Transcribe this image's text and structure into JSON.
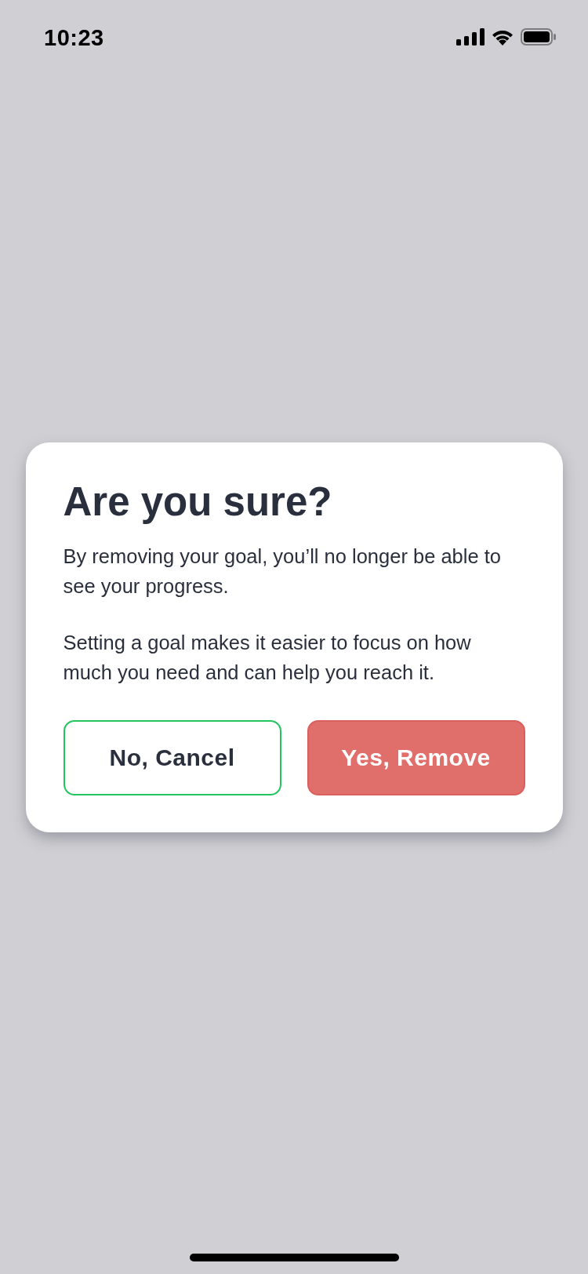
{
  "status_bar": {
    "time": "10:23"
  },
  "dialog": {
    "title": "Are you sure?",
    "paragraphs": [
      "By removing your goal, you’ll no longer be able to see your progress.",
      "Setting a goal makes it easier to focus on how much you need and can help you reach it."
    ],
    "buttons": [
      {
        "label": "No, Cancel",
        "kind": "secondary"
      },
      {
        "label": "Yes, Remove",
        "kind": "destructive"
      }
    ]
  }
}
